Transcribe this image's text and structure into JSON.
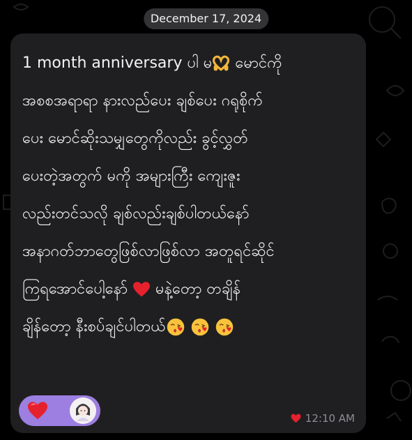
{
  "date_separator": "December 17, 2024",
  "message": {
    "lines": [
      [
        "1 month anniversary ပါ မ",
        "emoji:heart-hands",
        " မောင်ကို"
      ],
      [
        "အစစအရာရာ နားလည်ပေး ချစ်ပေး ဂရုစိုက်"
      ],
      [
        "ပေး မောင်ဆိုးသမျှ‌တွေကိုလည်း ခွင့်လွှတ်"
      ],
      [
        "ပေးတဲ့အတွက် မကို အများကြီး ကျေးဇူး"
      ],
      [
        "လည်းတင်သလို ချစ်လည်းချစ်ပါတယ်နော်"
      ],
      [
        "အနာဂတ်ဘာတွေဖြစ်လာဖြစ်လာ အတူရင်ဆိုင်"
      ],
      [
        "ကြရအောင်ပေါ့နော် ",
        "emoji:red-heart",
        " မနဲ့တော့ တချိန်"
      ],
      [
        "ချိန်‌တော့ နီးစပ်ချင်ပါတယ်",
        "emoji:kissing-face",
        " ",
        "emoji:kissing-face",
        " ",
        "emoji:kissing-face"
      ]
    ],
    "time": "12:10 AM",
    "status_icon": "heart-icon"
  },
  "reaction": {
    "emoji": "red-heart",
    "reactor": "avatar"
  },
  "colors": {
    "bubble": "#1f1f21",
    "reaction_chip": "#9c7fe0",
    "heart": "#e5212e",
    "meta_text": "#8e8e93"
  }
}
